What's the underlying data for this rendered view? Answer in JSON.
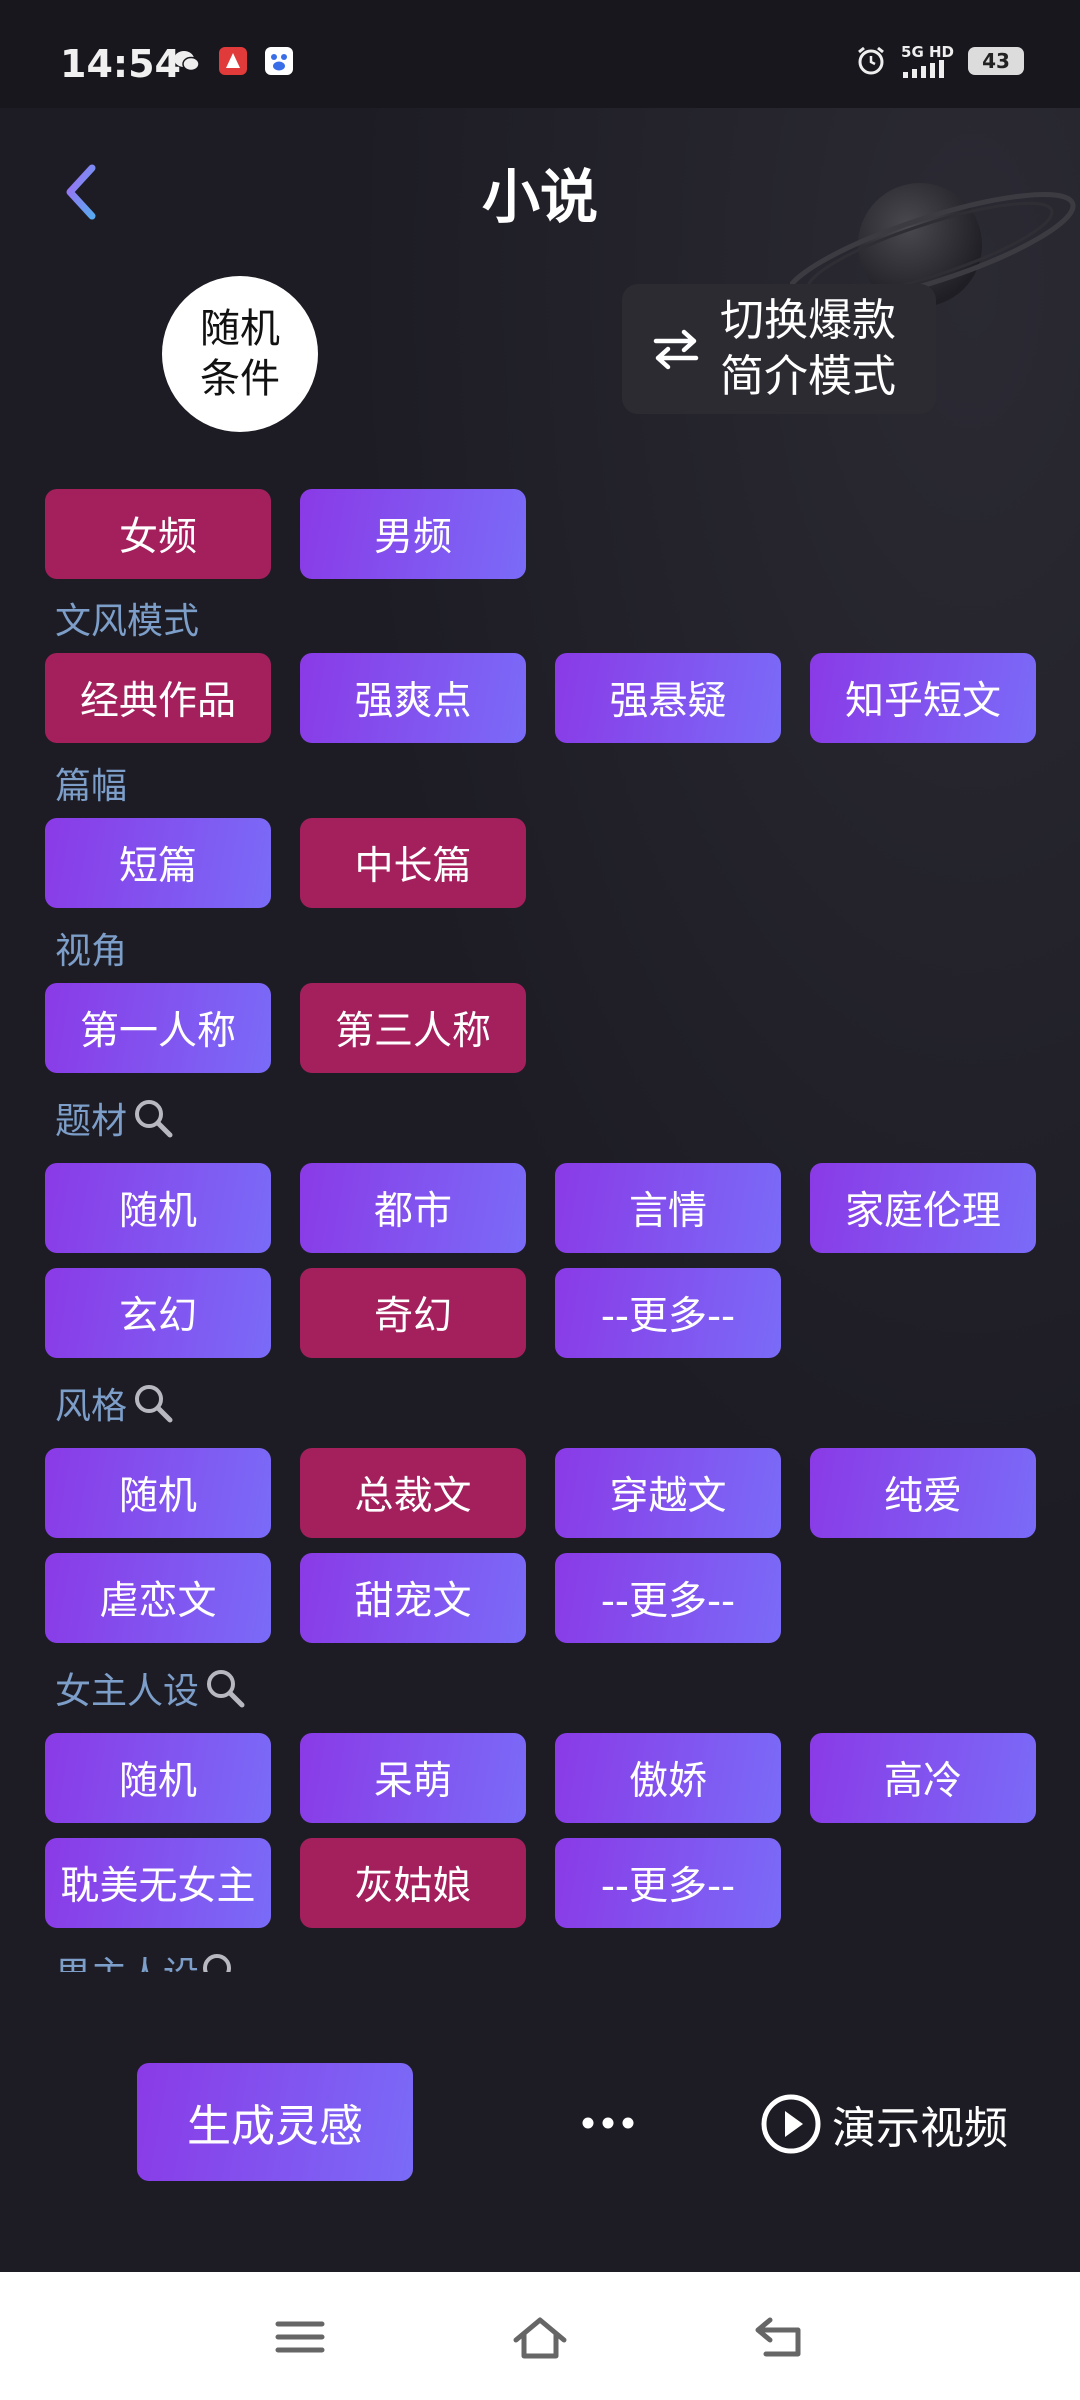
{
  "status_bar": {
    "time": "14:54",
    "network": "5G HD",
    "battery": "43",
    "app_icons": [
      "wechat-icon",
      "app-red-icon",
      "baidu-icon"
    ]
  },
  "header": {
    "title": "小说",
    "back_icon": "chevron-left-icon"
  },
  "controls": {
    "random_line1": "随机",
    "random_line2": "条件",
    "switch_line1": "切换爆款",
    "switch_line2": "简介模式"
  },
  "gender": [
    {
      "label": "女频",
      "selected": true
    },
    {
      "label": "男频",
      "selected": false
    }
  ],
  "sections": {
    "style_mode": {
      "label": "文风模式",
      "options": [
        {
          "label": "经典作品",
          "selected": true
        },
        {
          "label": "强爽点",
          "selected": false
        },
        {
          "label": "强悬疑",
          "selected": false
        },
        {
          "label": "知乎短文",
          "selected": false
        }
      ]
    },
    "length": {
      "label": "篇幅",
      "options": [
        {
          "label": "短篇",
          "selected": false
        },
        {
          "label": "中长篇",
          "selected": true
        }
      ]
    },
    "perspective": {
      "label": "视角",
      "options": [
        {
          "label": "第一人称",
          "selected": false
        },
        {
          "label": "第三人称",
          "selected": true
        }
      ]
    },
    "theme": {
      "label": "题材",
      "options": [
        {
          "label": "随机",
          "selected": false
        },
        {
          "label": "都市",
          "selected": false
        },
        {
          "label": "言情",
          "selected": false
        },
        {
          "label": "家庭伦理",
          "selected": false
        },
        {
          "label": "玄幻",
          "selected": false
        },
        {
          "label": "奇幻",
          "selected": true
        },
        {
          "label": "--更多--",
          "selected": false
        }
      ]
    },
    "genre_style": {
      "label": "风格",
      "options": [
        {
          "label": "随机",
          "selected": false
        },
        {
          "label": "总裁文",
          "selected": true
        },
        {
          "label": "穿越文",
          "selected": false
        },
        {
          "label": "纯爱",
          "selected": false
        },
        {
          "label": "虐恋文",
          "selected": false
        },
        {
          "label": "甜宠文",
          "selected": false
        },
        {
          "label": "--更多--",
          "selected": false
        }
      ]
    },
    "heroine": {
      "label": "女主人设",
      "options": [
        {
          "label": "随机",
          "selected": false
        },
        {
          "label": "呆萌",
          "selected": false
        },
        {
          "label": "傲娇",
          "selected": false
        },
        {
          "label": "高冷",
          "selected": false
        },
        {
          "label": "耽美无女主",
          "selected": false
        },
        {
          "label": "灰姑娘",
          "selected": true
        },
        {
          "label": "--更多--",
          "selected": false
        }
      ]
    },
    "hero_partial": {
      "label": "男主人设"
    }
  },
  "bottom": {
    "generate": "生成灵感",
    "more_icon": "more-dots-icon",
    "demo": "演示视频"
  },
  "colors": {
    "background": "#1d1c24",
    "chip_purple_start": "#8a3ae6",
    "chip_purple_end": "#7a6bf8",
    "chip_selected": "#a4205d",
    "section_label": "#7c9ec9"
  }
}
